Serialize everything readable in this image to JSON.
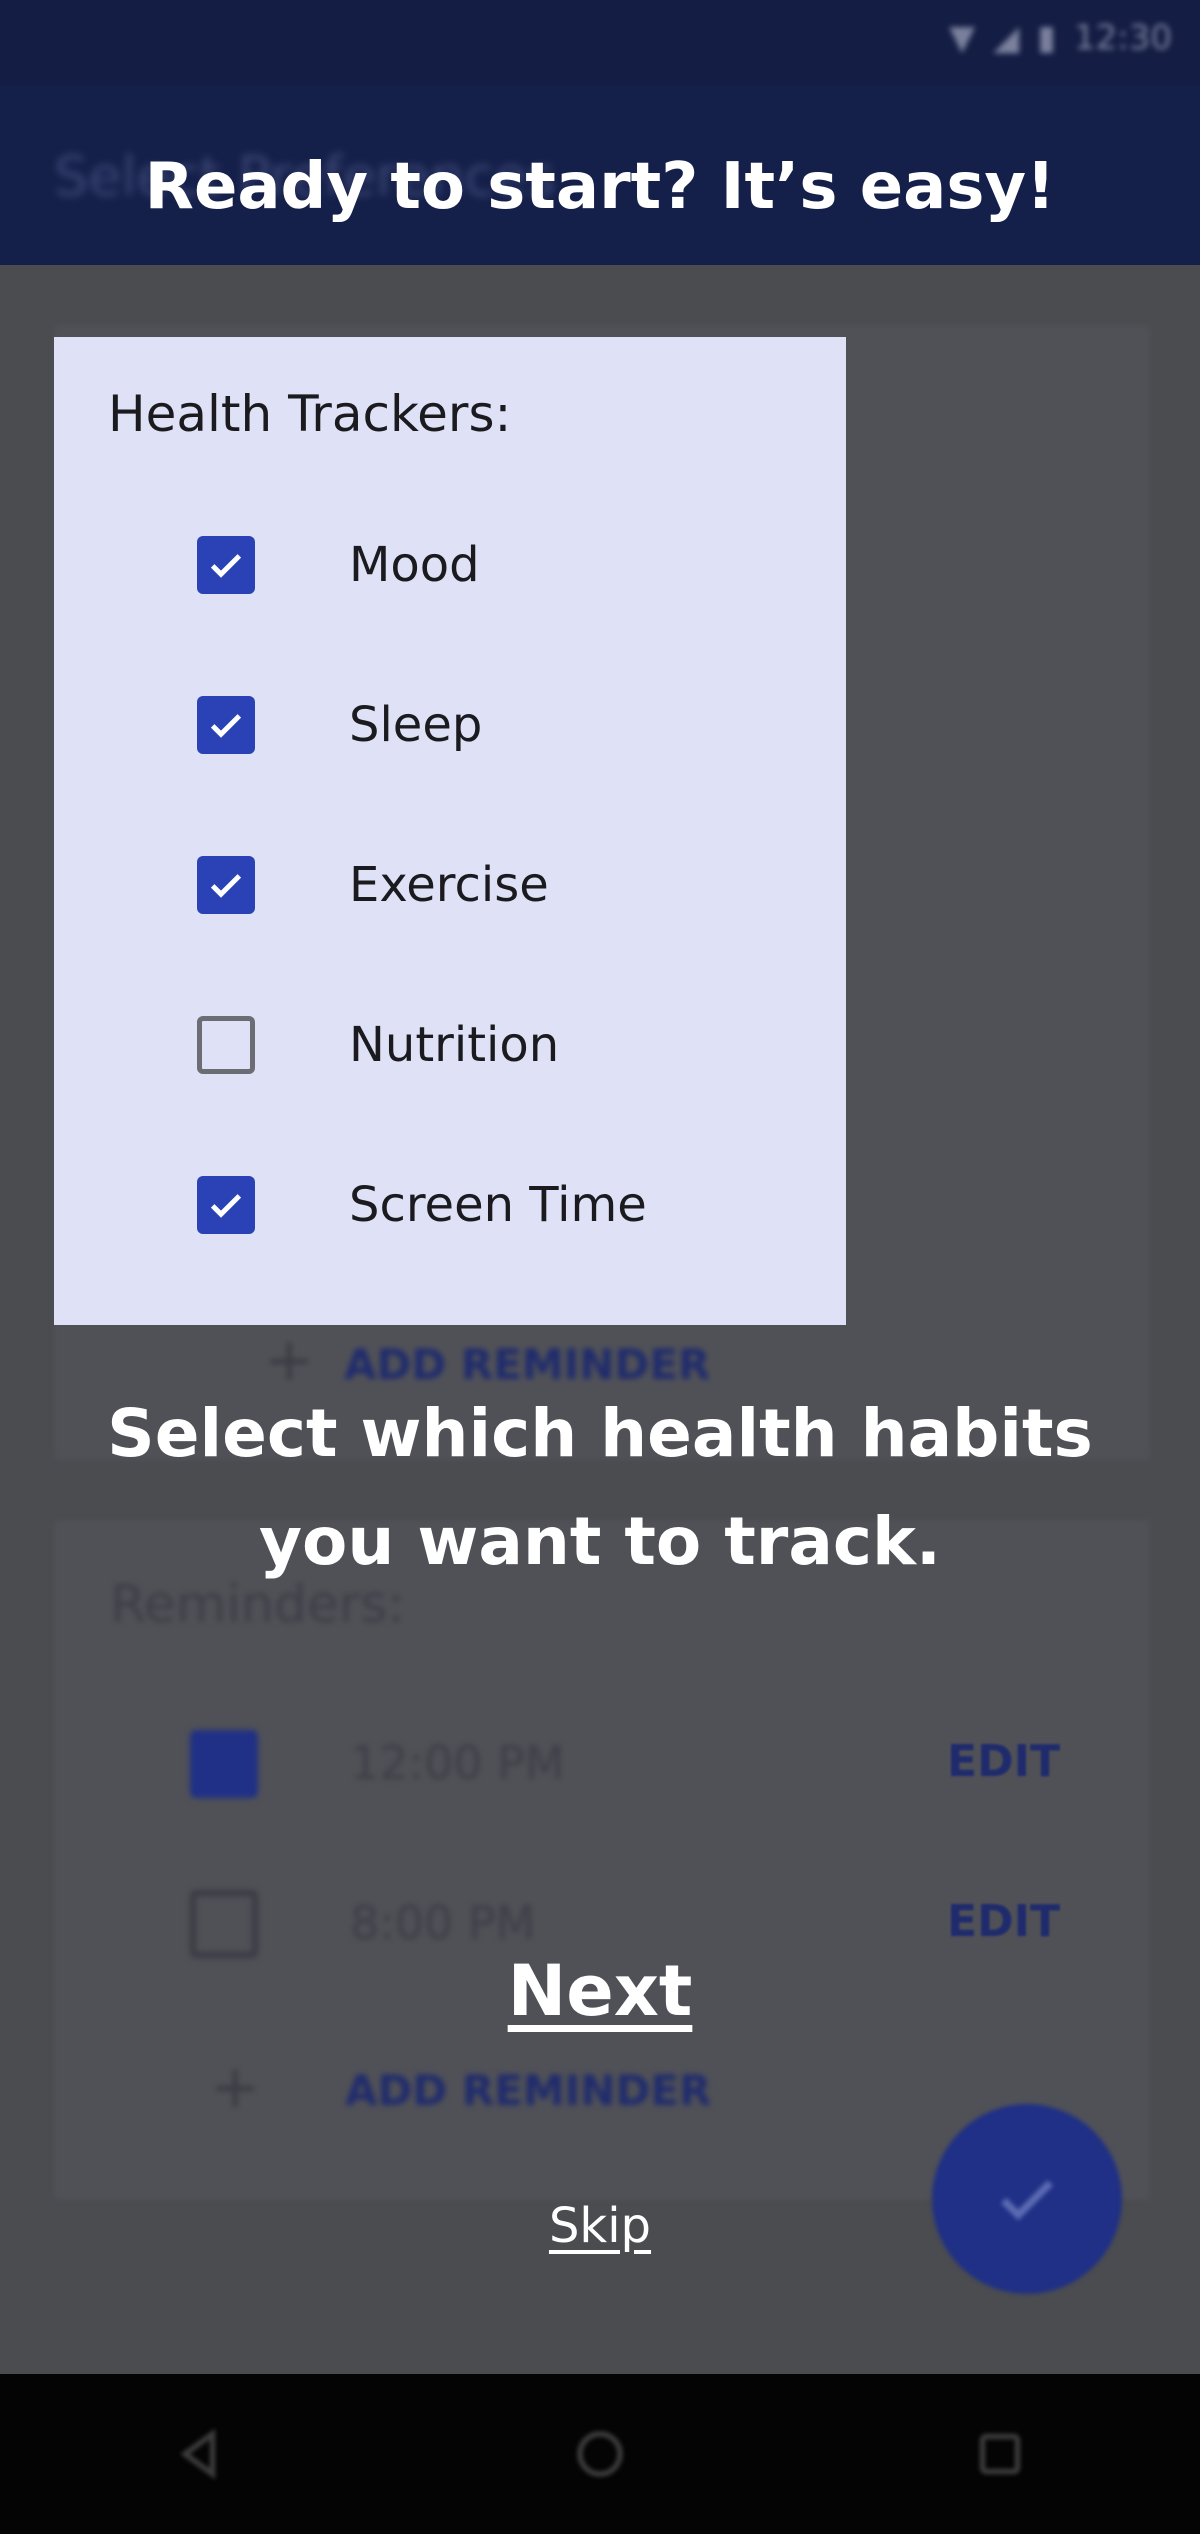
{
  "status_bar": {
    "time": "12:30"
  },
  "app_bar": {
    "title": "Select Preferences"
  },
  "background": {
    "add_reminder_label": "ADD REMINDER",
    "reminders_heading": "Reminders:",
    "reminders": [
      {
        "time": "12:00 PM",
        "checked": true,
        "action": "EDIT"
      },
      {
        "time": "8:00 PM",
        "checked": false,
        "action": "EDIT"
      }
    ],
    "add_reminder_label_2": "ADD REMINDER"
  },
  "overlay": {
    "headline": "Ready to start? It’s easy!",
    "tracker_card": {
      "heading": "Health Trackers:",
      "items": [
        {
          "label": "Mood",
          "checked": true
        },
        {
          "label": "Sleep",
          "checked": true
        },
        {
          "label": "Exercise",
          "checked": true
        },
        {
          "label": "Nutrition",
          "checked": false
        },
        {
          "label": "Screen Time",
          "checked": true
        }
      ]
    },
    "instruction_line1": "Select which health habits",
    "instruction_line2": "you want to track.",
    "next_label": "Next",
    "skip_label": "Skip"
  },
  "colors": {
    "overlay_dim": "#4b4c50",
    "app_bar": "#15204a",
    "card_bg": "#dfe2f7",
    "checkbox_accent": "#2a42b6",
    "nav_bar": "#040404"
  },
  "icons": {
    "status": [
      "wifi-icon",
      "signal-icon",
      "battery-icon"
    ],
    "fab": "check-icon",
    "nav": [
      "back-icon",
      "home-icon",
      "recents-icon"
    ]
  }
}
